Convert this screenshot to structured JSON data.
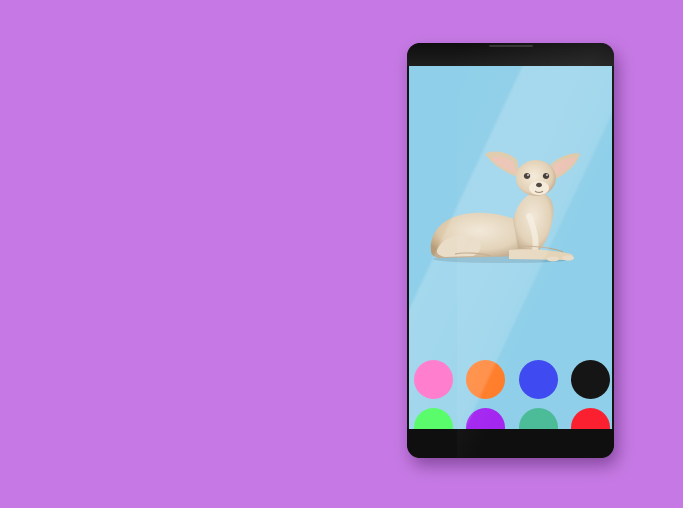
{
  "background_color": "#c679e4",
  "phone": {
    "screen_color": "#8fcfe9",
    "bezel_color": "#141414",
    "image": {
      "icon": "chihuahua-dog-image"
    },
    "color_swatches": [
      {
        "name": "pink",
        "color": "#ff66c4"
      },
      {
        "name": "orange",
        "color": "#ff7d2a"
      },
      {
        "name": "blue",
        "color": "#3f4bf0"
      },
      {
        "name": "black",
        "color": "#151515"
      },
      {
        "name": "green",
        "color": "#3cfb50"
      },
      {
        "name": "purple",
        "color": "#a427f0"
      },
      {
        "name": "teal",
        "color": "#4cbc98"
      },
      {
        "name": "red",
        "color": "#fa2030"
      }
    ]
  }
}
